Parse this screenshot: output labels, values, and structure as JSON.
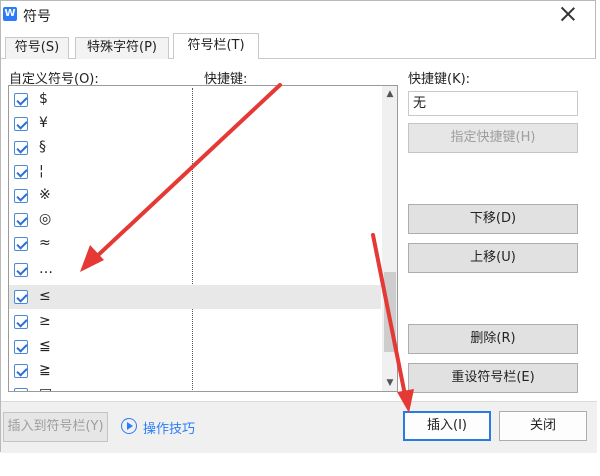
{
  "window": {
    "title": "符号",
    "app_icon_letter": "W"
  },
  "tabs": [
    {
      "label": "符号(S)",
      "active": false
    },
    {
      "label": "特殊字符(P)",
      "active": false
    },
    {
      "label": "符号栏(T)",
      "active": true
    }
  ],
  "list": {
    "header_symbol": "自定义符号(O):",
    "header_shortcut": "快捷键:",
    "rows": [
      {
        "symbol": "$",
        "checked": true,
        "selected": false
      },
      {
        "symbol": "¥",
        "checked": true,
        "selected": false
      },
      {
        "symbol": "§",
        "checked": true,
        "selected": false
      },
      {
        "symbol": "¦",
        "checked": true,
        "selected": false
      },
      {
        "symbol": "※",
        "checked": true,
        "selected": false
      },
      {
        "symbol": "◎",
        "checked": true,
        "selected": false
      },
      {
        "symbol": "≈",
        "checked": true,
        "selected": false
      },
      {
        "symbol": "…",
        "checked": true,
        "selected": false
      },
      {
        "symbol": "≤",
        "checked": true,
        "selected": true
      },
      {
        "symbol": "≥",
        "checked": true,
        "selected": false
      },
      {
        "symbol": "≦",
        "checked": true,
        "selected": false
      },
      {
        "symbol": "≧",
        "checked": true,
        "selected": false
      },
      {
        "symbol": "□",
        "checked": true,
        "selected": false
      }
    ]
  },
  "shortcut": {
    "label": "快捷键(K):",
    "value": "无",
    "assign_button": "指定快捷键(H)"
  },
  "buttons": {
    "move_down": "下移(D)",
    "move_up": "上移(U)",
    "delete": "删除(R)",
    "reset": "重设符号栏(E)",
    "insert_to_bar": "插入到符号栏(Y)",
    "tips": "操作技巧",
    "insert": "插入(I)",
    "close": "关闭"
  },
  "colors": {
    "accent": "#2b7cf6",
    "arrow": "#e53935"
  },
  "icons": {
    "window": "wps-icon",
    "close": "close-icon",
    "checkbox": "check-icon",
    "tips": "play-circle-icon"
  }
}
